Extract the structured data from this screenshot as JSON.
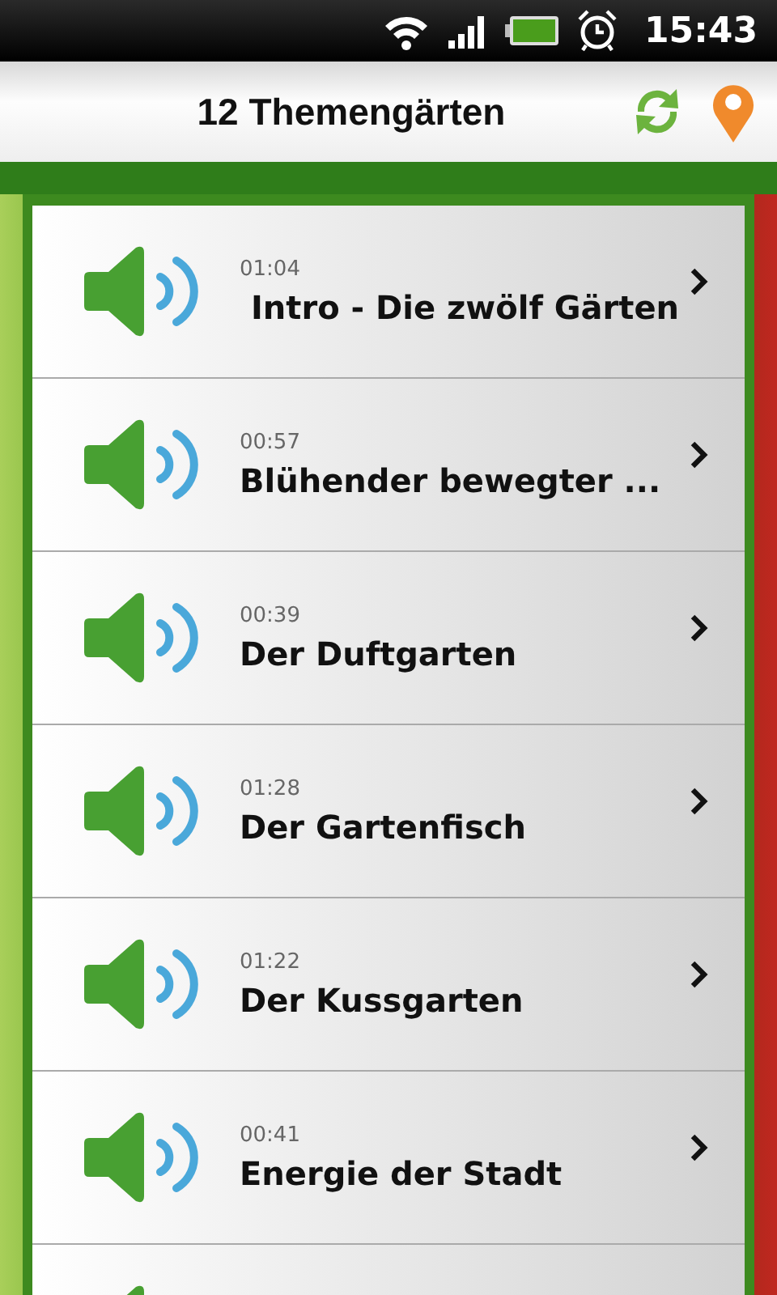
{
  "status_bar": {
    "time": "15:43"
  },
  "header": {
    "title": "12 Themengärten"
  },
  "tracks": [
    {
      "duration": "01:04",
      "title": " Intro - Die zwölf Gärten"
    },
    {
      "duration": "00:57",
      "title": "Blühender bewegter ..."
    },
    {
      "duration": "00:39",
      "title": "Der Duftgarten"
    },
    {
      "duration": "01:28",
      "title": "Der Gartenfisch"
    },
    {
      "duration": "01:22",
      "title": "Der Kussgarten"
    },
    {
      "duration": "00:41",
      "title": "Energie der Stadt"
    }
  ]
}
